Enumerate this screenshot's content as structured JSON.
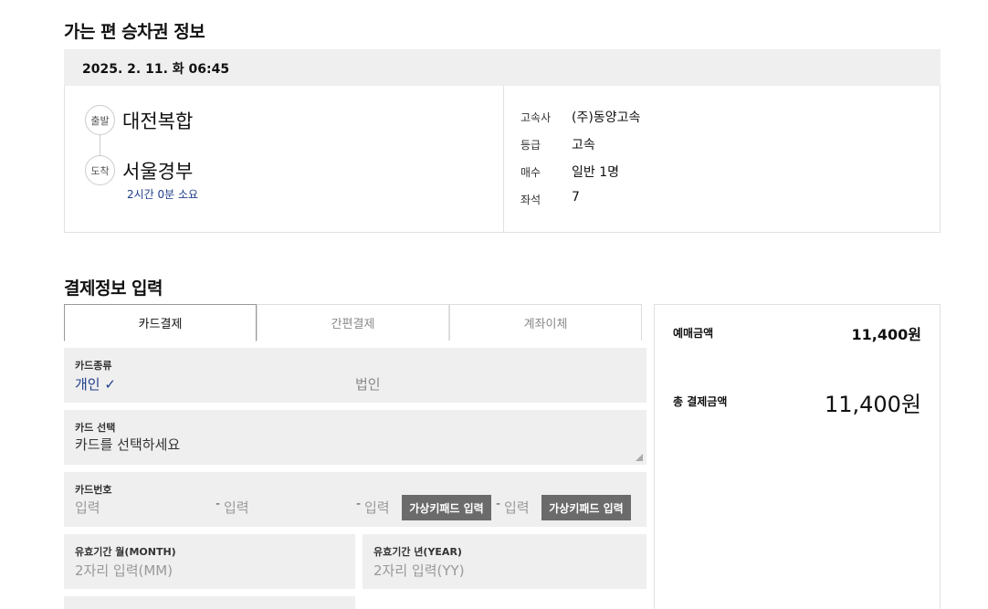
{
  "outbound": {
    "title": "가는 편 승차권 정보",
    "datetime": "2025. 2. 11. 화 06:45",
    "departure": {
      "badge": "출발",
      "name": "대전복합"
    },
    "arrival": {
      "badge": "도착",
      "name": "서울경부"
    },
    "duration": "2시간 0분 소요",
    "details": [
      {
        "key": "고속사",
        "value": "(주)동양고속"
      },
      {
        "key": "등급",
        "value": "고속"
      },
      {
        "key": "매수",
        "value": "일반 1명"
      },
      {
        "key": "좌석",
        "value": "7"
      }
    ]
  },
  "payment": {
    "title": "결제정보 입력",
    "tabs": [
      {
        "label": "카드결제",
        "active": true
      },
      {
        "label": "간편결제",
        "active": false
      },
      {
        "label": "계좌이체",
        "active": false
      }
    ],
    "card_type": {
      "label": "카드종류",
      "options": [
        {
          "label": "개인 ✓",
          "selected": true
        },
        {
          "label": "법인",
          "selected": false
        }
      ]
    },
    "card_select": {
      "label": "카드 선택",
      "placeholder": "카드를 선택하세요"
    },
    "card_number": {
      "label": "카드번호",
      "segments": [
        {
          "placeholder": "입력"
        },
        {
          "placeholder": "입력"
        },
        {
          "placeholder": "입력"
        },
        {
          "placeholder": "입력"
        }
      ],
      "dash": "-",
      "keypad_label": "가상키패드 입력"
    },
    "expiry_month": {
      "label": "유효기간 월(MONTH)",
      "placeholder": "2자리 입력(MM)"
    },
    "expiry_year": {
      "label": "유효기간 년(YEAR)",
      "placeholder": "2자리 입력(YY)"
    }
  },
  "summary": {
    "fare_label": "예매금액",
    "fare_value": "11,400원",
    "total_label": "총 결제금액",
    "total_value": "11,400원"
  }
}
